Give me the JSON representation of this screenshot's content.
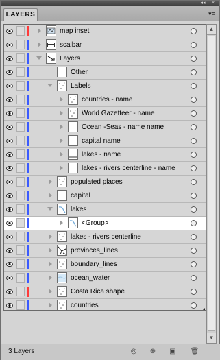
{
  "panel": {
    "tab_label": "LAYERS",
    "collapse_label": "◂◂",
    "close_label": "×",
    "menu_label": "▾≡",
    "layer_count": "3 Layers"
  },
  "layers": [
    {
      "name": "map inset",
      "indent": 0,
      "expander": "closed",
      "color": "#ff3b3b",
      "thumb": "map",
      "selected": false
    },
    {
      "name": "scalbar",
      "indent": 0,
      "expander": "closed",
      "color": "#3b5bff",
      "thumb": "bar",
      "selected": false
    },
    {
      "name": "Layers",
      "indent": 0,
      "expander": "open",
      "color": "#3b5bff",
      "thumb": "arrow",
      "selected": false
    },
    {
      "name": "Other",
      "indent": 1,
      "expander": "none",
      "color": "#3b5bff",
      "thumb": "blank",
      "selected": false
    },
    {
      "name": "Labels",
      "indent": 1,
      "expander": "open",
      "color": "#3b5bff",
      "thumb": "dots",
      "selected": false
    },
    {
      "name": "countries - name",
      "indent": 2,
      "expander": "closed",
      "color": "#3b5bff",
      "thumb": "dots",
      "selected": false
    },
    {
      "name": "World Gazetteer - name",
      "indent": 2,
      "expander": "closed",
      "color": "#3b5bff",
      "thumb": "dots",
      "selected": false
    },
    {
      "name": "Ocean -Seas - name name",
      "indent": 2,
      "expander": "closed",
      "color": "#3b5bff",
      "thumb": "blank",
      "selected": false
    },
    {
      "name": "capital name",
      "indent": 2,
      "expander": "closed",
      "color": "#3b5bff",
      "thumb": "blank",
      "selected": false
    },
    {
      "name": "lakes - name",
      "indent": 2,
      "expander": "closed",
      "color": "#3b5bff",
      "thumb": "line",
      "selected": false
    },
    {
      "name": "lakes - rivers centerline - name",
      "indent": 2,
      "expander": "closed",
      "color": "#3b5bff",
      "thumb": "blank",
      "selected": false
    },
    {
      "name": "populated places",
      "indent": 1,
      "expander": "closed",
      "color": "#3b5bff",
      "thumb": "dots",
      "selected": false
    },
    {
      "name": "capital",
      "indent": 1,
      "expander": "closed",
      "color": "#3b5bff",
      "thumb": "blank",
      "selected": false
    },
    {
      "name": "lakes",
      "indent": 1,
      "expander": "open",
      "color": "#3b5bff",
      "thumb": "lake",
      "selected": false
    },
    {
      "name": "<Group>",
      "indent": 2,
      "expander": "closed",
      "color": "#3b5bff",
      "thumb": "lake",
      "selected": true
    },
    {
      "name": "lakes - rivers centerline",
      "indent": 1,
      "expander": "closed",
      "color": "#3b5bff",
      "thumb": "dots",
      "selected": false
    },
    {
      "name": "provinces_lines",
      "indent": 1,
      "expander": "closed",
      "color": "#3b5bff",
      "thumb": "lines",
      "selected": false
    },
    {
      "name": "boundary_lines",
      "indent": 1,
      "expander": "closed",
      "color": "#3b5bff",
      "thumb": "dots",
      "selected": false
    },
    {
      "name": "ocean_water",
      "indent": 1,
      "expander": "closed",
      "color": "#3b5bff",
      "thumb": "water",
      "selected": false
    },
    {
      "name": "Costa Rica shape",
      "indent": 1,
      "expander": "closed",
      "color": "#ff3b3b",
      "thumb": "dots",
      "selected": false
    },
    {
      "name": "countries",
      "indent": 1,
      "expander": "closed",
      "color": "#3b5bff",
      "thumb": "dots",
      "selected": false
    }
  ],
  "bottom_buttons": [
    {
      "name": "make-clipping-mask-button",
      "glyph": "◎"
    },
    {
      "name": "create-sublayer-button",
      "glyph": "⊕"
    },
    {
      "name": "create-new-layer-button",
      "glyph": "▣"
    },
    {
      "name": "delete-layer-button",
      "glyph": "🗑"
    }
  ]
}
